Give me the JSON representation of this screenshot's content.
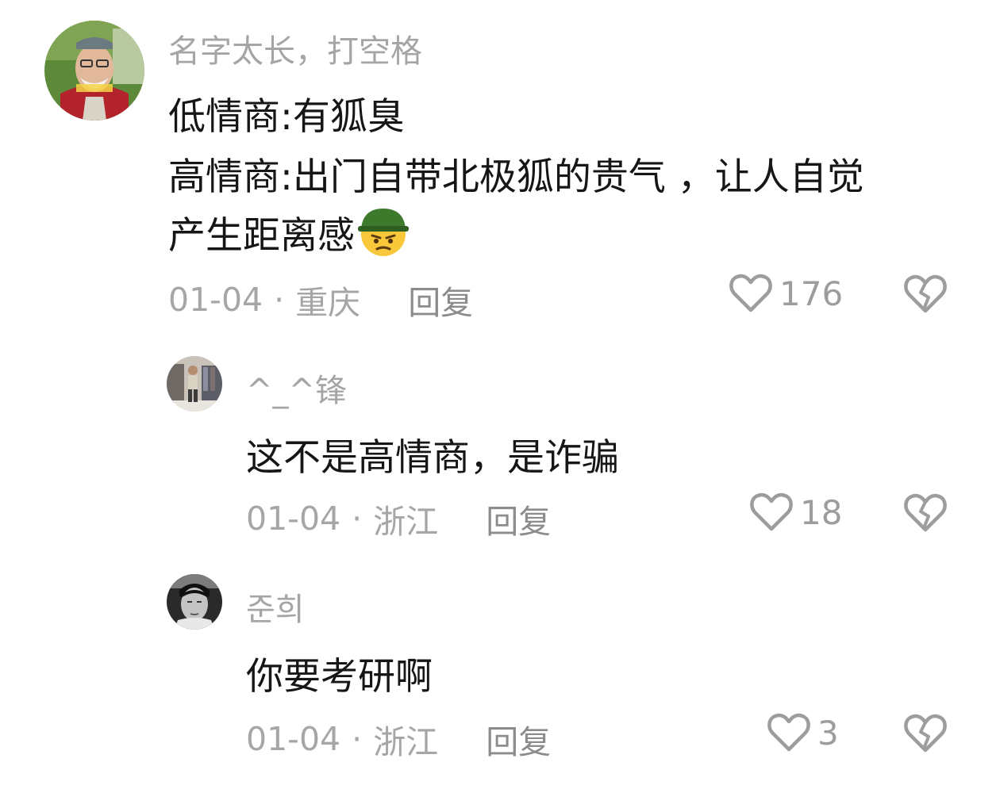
{
  "comments": [
    {
      "username": "名字太长，打空格",
      "lines": [
        "低情商:有狐臭",
        "高情商:出门自带北极狐的贵气 ，让人自觉",
        "产生距离感"
      ],
      "emoji": "helmet-thinking-face-emoji",
      "date": "01-04",
      "separator": "·",
      "location": "重庆",
      "reply_label": "回复",
      "likes": "176"
    },
    {
      "username": "^_^锋",
      "lines": [
        "这不是高情商，是诈骗"
      ],
      "date": "01-04",
      "separator": "·",
      "location": "浙江",
      "reply_label": "回复",
      "likes": "18"
    },
    {
      "username": "준희",
      "lines": [
        "你要考研啊"
      ],
      "date": "01-04",
      "separator": "·",
      "location": "浙江",
      "reply_label": "回复",
      "likes": "3"
    }
  ],
  "icons": {
    "like": "heart-outline-icon",
    "dislike": "broken-heart-icon"
  },
  "colors": {
    "username": "#a5a5a5",
    "text": "#161616",
    "meta": "#a6a6a6",
    "icon": "#9d9d9d"
  }
}
